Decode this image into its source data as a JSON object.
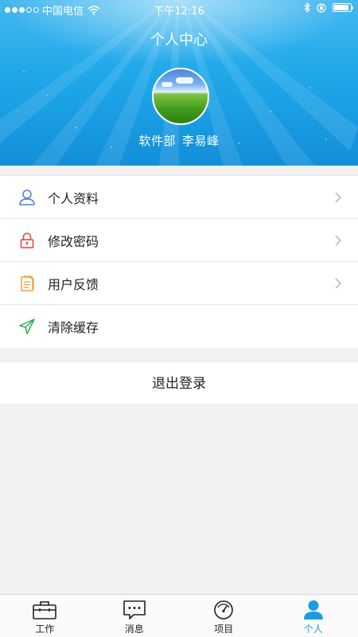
{
  "status_bar": {
    "carrier": "中国电信",
    "time": "下午12:16",
    "signal_dots": 5,
    "signal_filled": 3,
    "battery_level": 0.9
  },
  "header": {
    "title": "个人中心",
    "department": "软件部",
    "user_name": "李易峰"
  },
  "menu": {
    "items": [
      {
        "label": "个人资料",
        "icon": "person-icon",
        "icon_color": "#4a7fd4",
        "has_arrow": true
      },
      {
        "label": "修改密码",
        "icon": "lock-icon",
        "icon_color": "#e0443a",
        "has_arrow": true
      },
      {
        "label": "用户反馈",
        "icon": "document-icon",
        "icon_color": "#f0a23a",
        "has_arrow": true
      },
      {
        "label": "清除缓存",
        "icon": "paper-plane-icon",
        "icon_color": "#2fae4f",
        "has_arrow": false
      }
    ]
  },
  "logout": {
    "label": "退出登录"
  },
  "tabbar": {
    "tabs": [
      {
        "label": "工作",
        "icon": "briefcase-icon",
        "active": false
      },
      {
        "label": "消息",
        "icon": "chat-bubble-icon",
        "active": false
      },
      {
        "label": "项目",
        "icon": "gauge-icon",
        "active": false
      },
      {
        "label": "个人",
        "icon": "person-filled-icon",
        "active": true
      }
    ]
  },
  "colors": {
    "header_top": "#43b8ef",
    "header_bottom": "#128fda",
    "accent": "#1b9be5",
    "page_background": "#f2f2f3"
  }
}
